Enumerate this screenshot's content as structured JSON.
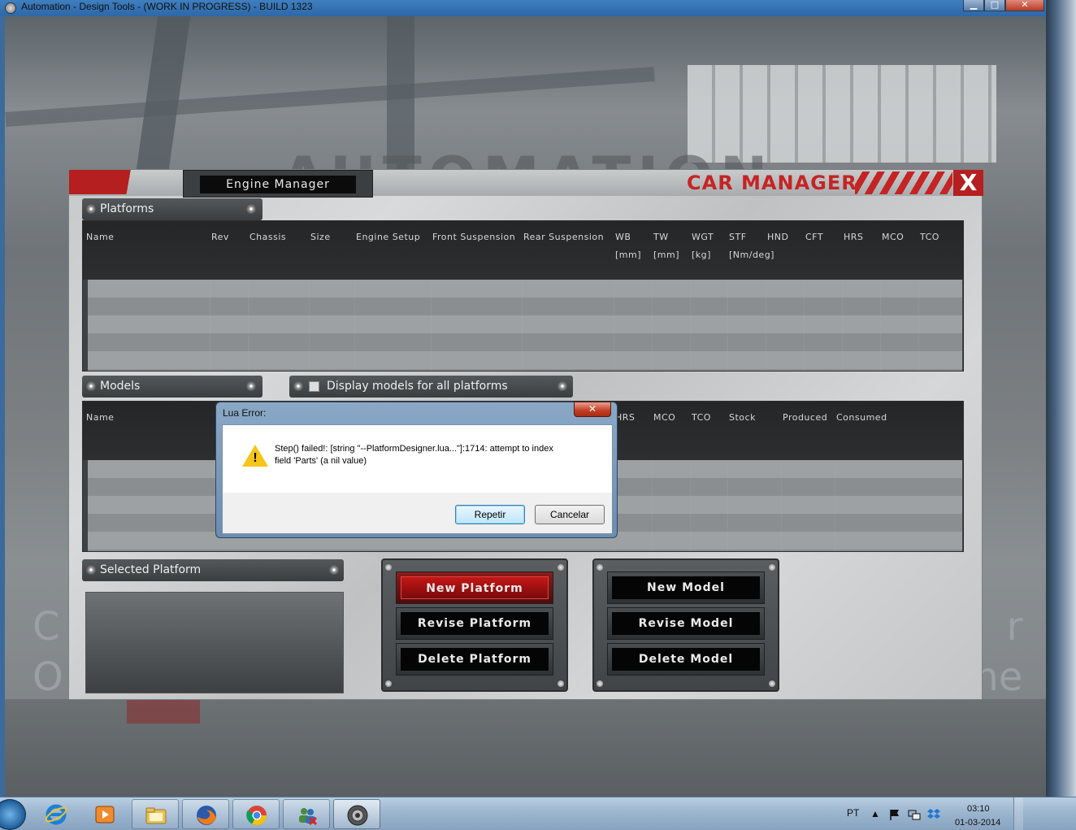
{
  "window": {
    "title": "Automation - Design Tools - (WORK IN PROGRESS) - BUILD 1323",
    "minimize_label": "▁",
    "maximize_label": "□",
    "close_label": "✕"
  },
  "background": {
    "ghost_left": "C\nO",
    "ghost_right": "r\nme"
  },
  "car_manager": {
    "title": "CAR MANAGER",
    "close_label": "X",
    "engine_tab": "Engine Manager",
    "platforms": {
      "label": "Platforms",
      "columns": [
        {
          "label": "Name",
          "unit": ""
        },
        {
          "label": "Rev",
          "unit": ""
        },
        {
          "label": "Chassis",
          "unit": ""
        },
        {
          "label": "Size",
          "unit": ""
        },
        {
          "label": "Engine Setup",
          "unit": ""
        },
        {
          "label": "Front Suspension",
          "unit": ""
        },
        {
          "label": "Rear Suspension",
          "unit": ""
        },
        {
          "label": "WB",
          "unit": "[mm]"
        },
        {
          "label": "TW",
          "unit": "[mm]"
        },
        {
          "label": "WGT",
          "unit": "[kg]"
        },
        {
          "label": "STF",
          "unit": "[Nm/deg]"
        },
        {
          "label": "HND",
          "unit": ""
        },
        {
          "label": "CFT",
          "unit": ""
        },
        {
          "label": "HRS",
          "unit": ""
        },
        {
          "label": "MCO",
          "unit": ""
        },
        {
          "label": "TCO",
          "unit": ""
        }
      ]
    },
    "models": {
      "label": "Models",
      "display_all_label": "Display models for all platforms",
      "columns": [
        "Name",
        "HRS",
        "MCO",
        "TCO",
        "Stock",
        "Produced",
        "Consumed"
      ]
    },
    "selected_platform": {
      "label": "Selected Platform"
    },
    "platform_buttons": {
      "new": "New Platform",
      "revise": "Revise Platform",
      "delete": "Delete Platform"
    },
    "model_buttons": {
      "new": "New Model",
      "revise": "Revise Model",
      "delete": "Delete Model"
    }
  },
  "dialog": {
    "title": "Lua Error:",
    "close_label": "✕",
    "message_line1": "Step() failed!: [string \"--PlatformDesigner.lua...\"]:1714: attempt to index",
    "message_line2": "field 'Parts' (a nil value)",
    "retry_label": "Repetir",
    "cancel_label": "Cancelar",
    "icon": "warning-icon"
  },
  "taskbar": {
    "items": [
      "start-orb",
      "internet-explorer",
      "media-player",
      "file-explorer",
      "firefox",
      "chrome",
      "network-app",
      "automation-game"
    ],
    "language": "PT",
    "time": "03:10",
    "date": "01-03-2014"
  }
}
